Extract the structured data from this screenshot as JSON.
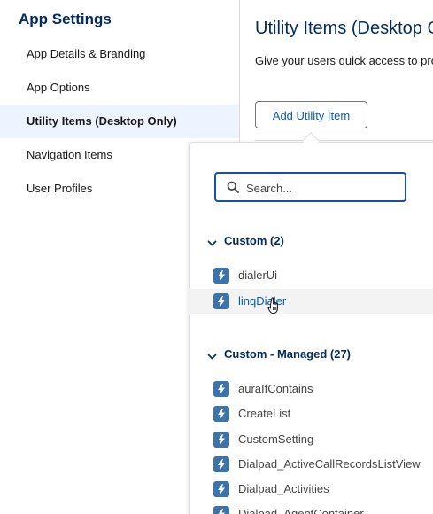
{
  "sidebar": {
    "title": "App Settings",
    "items": [
      {
        "label": "App Details & Branding"
      },
      {
        "label": "App Options"
      },
      {
        "label": "Utility Items (Desktop Only)"
      },
      {
        "label": "Navigation Items"
      },
      {
        "label": "User Profiles"
      }
    ],
    "active_index": 2
  },
  "main": {
    "title": "Utility Items (Desktop Only)",
    "description": "Give your users quick access to productivity tools",
    "add_button_label": "Add Utility Item"
  },
  "dropdown": {
    "search_placeholder": "Search...",
    "groups": [
      {
        "header": "Custom (2)",
        "items": [
          "dialerUi",
          "linqDialer"
        ]
      },
      {
        "header": "Custom - Managed (27)",
        "items": [
          "auraIfContains",
          "CreateList",
          "CustomSetting",
          "Dialpad_ActiveCallRecordsListView",
          "Dialpad_Activities",
          "Dialpad_AgentContainer"
        ]
      }
    ],
    "hovered_item": "linqDialer"
  },
  "colors": {
    "brand_navy": "#032d60",
    "link_blue": "#0b5cab",
    "focus_blue": "#1b5297",
    "active_nav_bg": "#eef4ff",
    "icon_bg": "#3d73a8"
  },
  "icons": {
    "search": "search-icon",
    "chevron": "chevron-down-icon",
    "item": "lightning-icon",
    "cursor": "hand-cursor-icon"
  }
}
